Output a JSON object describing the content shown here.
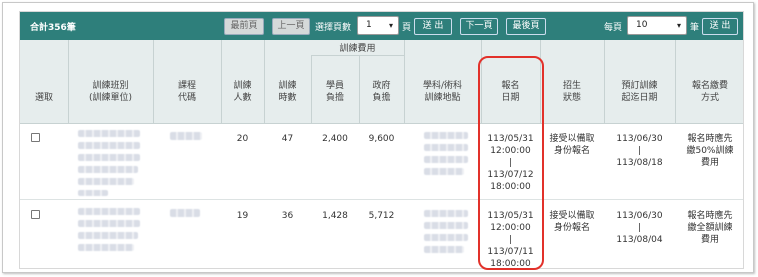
{
  "toolbar": {
    "total": "合計356筆",
    "first": "最前頁",
    "prev": "上一頁",
    "choose_page": "選擇頁數",
    "page_value": "1",
    "page_suffix": "頁",
    "send": "送 出",
    "next": "下一頁",
    "last": "最後頁",
    "per_page": "每頁",
    "per_page_value": "10",
    "per_page_suffix": "筆",
    "send2": "送 出"
  },
  "header": {
    "select": "選取",
    "course_name_1": "訓練班別",
    "course_name_2": "(訓練單位)",
    "course_code_1": "課程",
    "course_code_2": "代碼",
    "people_1": "訓練",
    "people_2": "人數",
    "hours_1": "訓練",
    "hours_2": "時數",
    "fee_group": "訓練費用",
    "student_1": "學員",
    "student_2": "負擔",
    "gov_1": "政府",
    "gov_2": "負擔",
    "location_1": "學科/術科",
    "location_2": "訓練地點",
    "signup_1": "報名",
    "signup_2": "日期",
    "status_1": "招生",
    "status_2": "狀態",
    "period_1": "預訂訓練",
    "period_2": "起迄日期",
    "payment_1": "報名繳費",
    "payment_2": "方式"
  },
  "rows": [
    {
      "people": "20",
      "hours": "47",
      "student_fee": "2,400",
      "gov_fee": "9,600",
      "signup_start_date": "113/05/31",
      "signup_start_time": "12:00:00",
      "signup_sep": "|",
      "signup_end_date": "113/07/12",
      "signup_end_time": "18:00:00",
      "status_1": "接受以備取",
      "status_2": "身份報名",
      "period_start": "113/06/30",
      "period_sep": "|",
      "period_end": "113/08/18",
      "payment_1": "報名時應先",
      "payment_2": "繳50%訓練",
      "payment_3": "費用"
    },
    {
      "people": "19",
      "hours": "36",
      "student_fee": "1,428",
      "gov_fee": "5,712",
      "signup_start_date": "113/05/31",
      "signup_start_time": "12:00:00",
      "signup_sep": "|",
      "signup_end_date": "113/07/11",
      "signup_end_time": "18:00:00",
      "status_1": "接受以備取",
      "status_2": "身份報名",
      "period_start": "113/06/30",
      "period_sep": "|",
      "period_end": "113/08/04",
      "payment_1": "報名時應先",
      "payment_2": "繳全額訓練",
      "payment_3": "費用"
    }
  ],
  "colors": {
    "bar": "#2e7f7b",
    "header_bg": "#e6eded",
    "highlight": "#e2312a"
  }
}
